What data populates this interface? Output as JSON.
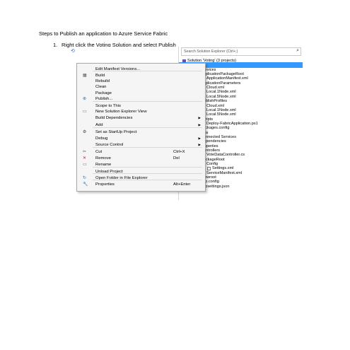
{
  "document": {
    "heading": "Steps to Publish an application to Azure Service Fabric",
    "step_number": "1.",
    "step_text": "Right click the Voting Solution and select Publish"
  },
  "explorer": {
    "search_placeholder": "Search Solution Explorer (Ctrl+;)",
    "nodes": [
      {
        "label": "Solution 'Voting' (3 projects)",
        "icon": "solution-icon"
      },
      {
        "label": "Voting",
        "icon": "project-icon"
      },
      {
        "label": "Services",
        "icon": "folder-icon"
      },
      {
        "label": "ApplicationPackageRoot",
        "icon": "folder-icon"
      },
      {
        "label": "ApplicationManifest.xml",
        "icon": "xml-file-icon"
      },
      {
        "label": "ApplicationParameters",
        "icon": "folder-icon"
      },
      {
        "label": "Cloud.xml",
        "icon": "xml-file-icon"
      },
      {
        "label": "Local.1Node.xml",
        "icon": "xml-file-icon"
      },
      {
        "label": "Local.5Node.xml",
        "icon": "xml-file-icon"
      },
      {
        "label": "PublishProfiles",
        "icon": "folder-icon"
      },
      {
        "label": "Cloud.xml",
        "icon": "xml-file-icon"
      },
      {
        "label": "Local.1Node.xml",
        "icon": "xml-file-icon"
      },
      {
        "label": "Local.5Node.xml",
        "icon": "xml-file-icon"
      },
      {
        "label": "Scripts",
        "icon": "folder-icon"
      },
      {
        "label": "Deploy-FabricApplication.ps1",
        "icon": "powershell-file-icon"
      },
      {
        "label": "packages.config",
        "icon": "config-file-icon"
      },
      {
        "label": "otingData",
        "icon": "project-icon"
      },
      {
        "label": "Connected Services",
        "icon": "connected-services-icon"
      },
      {
        "label": "Dependencies",
        "icon": "dependencies-icon"
      },
      {
        "label": "Properties",
        "icon": "wrench-icon"
      },
      {
        "label": "Controllers",
        "icon": "folder-icon"
      },
      {
        "label": "VoteDataController.cs",
        "icon": "csharp-file-icon"
      },
      {
        "label": "PackageRoot",
        "icon": "folder-icon"
      },
      {
        "label": "Config",
        "icon": "folder-icon"
      },
      {
        "label": "Settings.xml",
        "icon": "xml-file-icon"
      },
      {
        "label": "ServiceManifest.xml",
        "icon": "xml-file-icon"
      },
      {
        "label": "wwwroot",
        "icon": "globe-icon"
      },
      {
        "label": "app.config",
        "icon": "config-file-icon"
      },
      {
        "label": "appsettings.json",
        "icon": "json-file-icon"
      }
    ]
  },
  "menu": {
    "items": [
      {
        "label": "Edit Manifest Versions...",
        "shortcut": "",
        "icon": ""
      },
      {
        "label": "Build",
        "shortcut": "",
        "icon": "build-icon"
      },
      {
        "label": "Rebuild",
        "shortcut": "",
        "icon": ""
      },
      {
        "label": "Clean",
        "shortcut": "",
        "icon": ""
      },
      {
        "label": "Package",
        "shortcut": "",
        "icon": ""
      },
      {
        "label": "Publish...",
        "shortcut": "",
        "icon": "publish-icon"
      },
      {
        "label": "Scope to This",
        "shortcut": "",
        "icon": ""
      },
      {
        "label": "New Solution Explorer View",
        "shortcut": "",
        "icon": "new-view-icon"
      },
      {
        "label": "Build Dependencies",
        "shortcut": "",
        "icon": "",
        "submenu": true
      },
      {
        "label": "Add",
        "shortcut": "",
        "icon": "",
        "submenu": true
      },
      {
        "label": "Set as StartUp Project",
        "shortcut": "",
        "icon": "gear-icon"
      },
      {
        "label": "Debug",
        "shortcut": "",
        "icon": "",
        "submenu": true
      },
      {
        "label": "Source Control",
        "shortcut": "",
        "icon": "",
        "submenu": true
      },
      {
        "label": "Cut",
        "shortcut": "Ctrl+X",
        "icon": "scissors-icon"
      },
      {
        "label": "Remove",
        "shortcut": "Del",
        "icon": "remove-icon"
      },
      {
        "label": "Rename",
        "shortcut": "",
        "icon": "rename-icon"
      },
      {
        "label": "Unload Project",
        "shortcut": "",
        "icon": ""
      },
      {
        "label": "Open Folder in File Explorer",
        "shortcut": "",
        "icon": "refresh-icon"
      },
      {
        "label": "Properties",
        "shortcut": "Alt+Enter",
        "icon": "wrench-icon"
      }
    ]
  },
  "colors": {
    "selection": "#3399ff",
    "menu_background": "#f5f5f5",
    "menu_border": "#a8a8a8"
  }
}
